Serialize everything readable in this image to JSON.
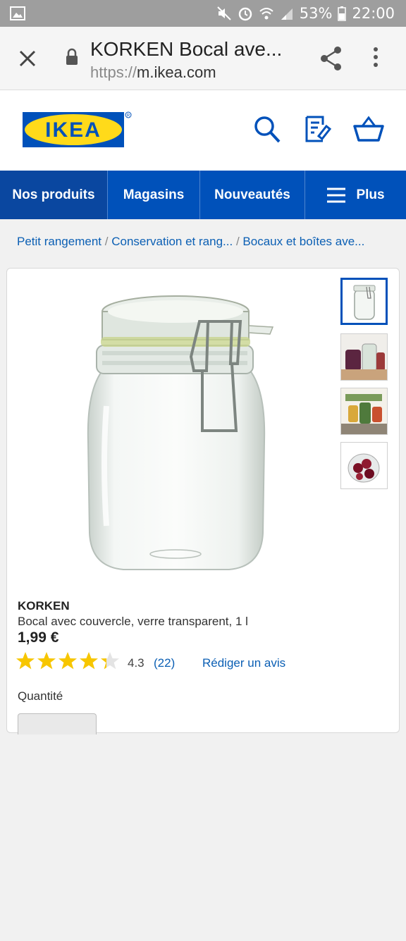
{
  "status_bar": {
    "battery": "53%",
    "time": "22:00",
    "icons": [
      "gallery-icon",
      "mute-icon",
      "alarm-icon",
      "wifi-icon",
      "signal-icon",
      "battery-icon"
    ]
  },
  "browser": {
    "title": "KORKEN Bocal ave...",
    "url_protocol": "https://",
    "url_host": "m.ikea.com"
  },
  "header": {
    "logo_text": "IKEA",
    "colors": {
      "logo_blue": "#0051ba",
      "logo_yellow": "#ffda1a"
    }
  },
  "nav": {
    "items": [
      {
        "label": "Nos produits"
      },
      {
        "label": "Magasins"
      },
      {
        "label": "Nouveautés"
      },
      {
        "label": "Plus"
      }
    ]
  },
  "breadcrumb": {
    "items": [
      "Petit rangement",
      "Conservation et rang...",
      "Bocaux et boîtes ave..."
    ],
    "separator": "/"
  },
  "product": {
    "name": "KORKEN",
    "description": "Bocal avec couvercle, verre transparent, 1 l",
    "price": "1,99 €",
    "rating_value": "4.3",
    "rating_fraction": 0.86,
    "rating_count": "(22)",
    "write_review": "Rédiger un avis",
    "quantity_label": "Quantité"
  }
}
